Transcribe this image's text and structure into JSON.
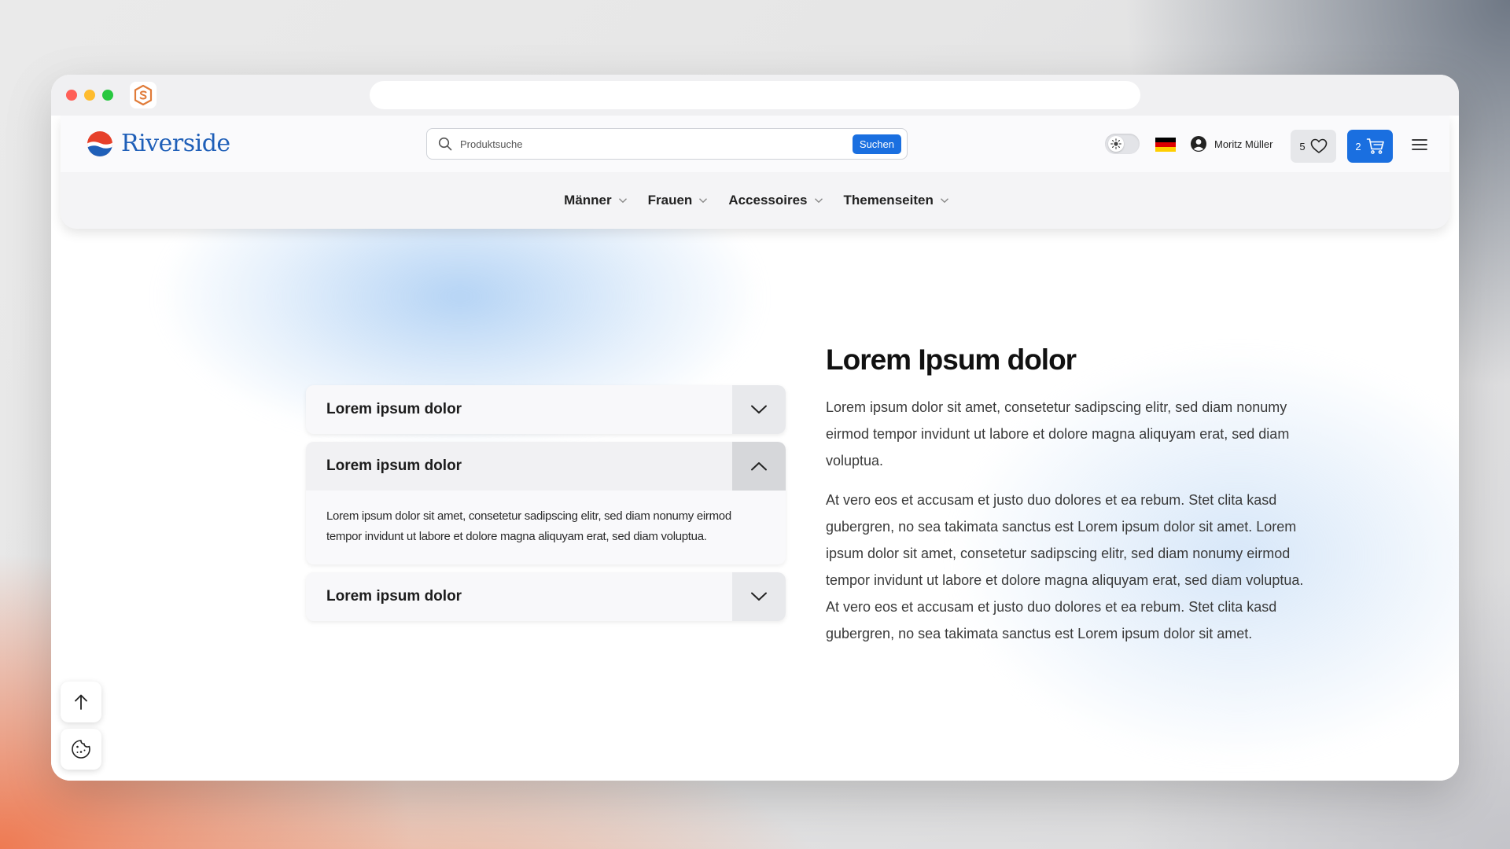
{
  "header": {
    "logo_text": "Riverside",
    "search": {
      "placeholder": "Produktsuche",
      "button_label": "Suchen"
    },
    "user_name": "Moritz Müller",
    "wishlist_count": "5",
    "cart_count": "2",
    "brand_color": "#1a6fe0"
  },
  "nav": {
    "items": [
      {
        "label": "Männer"
      },
      {
        "label": "Frauen"
      },
      {
        "label": "Accessoires"
      },
      {
        "label": "Themenseiten"
      }
    ]
  },
  "accordion": {
    "items": [
      {
        "title": "Lorem ipsum dolor",
        "open": false
      },
      {
        "title": "Lorem ipsum dolor",
        "open": true,
        "body": "Lorem ipsum dolor sit amet, consetetur sadipscing elitr, sed diam nonumy eirmod tempor invidunt ut labore et dolore magna aliquyam erat, sed diam voluptua."
      },
      {
        "title": "Lorem ipsum dolor",
        "open": false
      }
    ]
  },
  "content": {
    "heading": "Lorem Ipsum dolor",
    "paragraph1": "Lorem ipsum dolor sit amet, consetetur sadipscing elitr, sed diam nonumy eirmod tempor invidunt ut labore et dolore magna aliquyam erat, sed diam voluptua.",
    "paragraph2": "At vero eos et accusam et justo duo dolores et ea rebum. Stet clita kasd gubergren, no sea takimata sanctus est Lorem ipsum dolor sit amet. Lorem ipsum dolor sit amet, consetetur sadipscing elitr, sed diam nonumy eirmod tempor invidunt ut labore et dolore magna aliquyam erat, sed diam voluptua. At vero eos et accusam et justo duo dolores et ea rebum. Stet clita kasd gubergren, no sea takimata sanctus est Lorem ipsum dolor sit amet."
  },
  "icons": {
    "extension": "shield-s-icon",
    "search": "search-icon",
    "theme": "sun-icon",
    "language": "german-flag-icon",
    "user": "user-circle-icon",
    "wishlist": "heart-icon",
    "cart": "cart-icon",
    "menu": "hamburger-icon",
    "scroll_top": "arrow-up-icon",
    "cookie": "cookie-icon"
  }
}
